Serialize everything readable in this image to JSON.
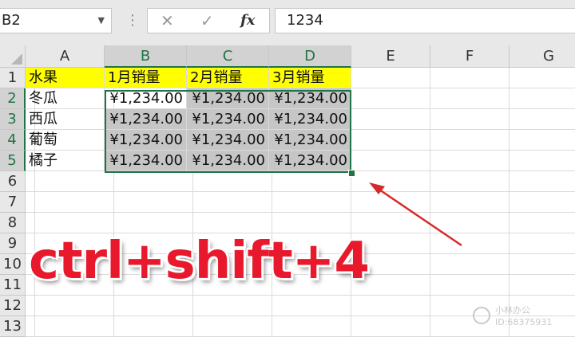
{
  "name_box": {
    "value": "B2"
  },
  "formula_bar": {
    "cancel_icon": "✕",
    "enter_icon": "✓",
    "fx_label": "fx",
    "value": "1234"
  },
  "columns": [
    "A",
    "B",
    "C",
    "D",
    "E",
    "F",
    "G"
  ],
  "rows": [
    "1",
    "2",
    "3",
    "4",
    "5",
    "6",
    "7",
    "8",
    "9",
    "10",
    "11",
    "12",
    "13"
  ],
  "cells": {
    "r1": [
      "水果",
      "1月销量",
      "2月销量",
      "3月销量"
    ],
    "r2": [
      "冬瓜",
      "¥1,234.00",
      "¥1,234.00",
      "¥1,234.00"
    ],
    "r3": [
      "西瓜",
      "¥1,234.00",
      "¥1,234.00",
      "¥1,234.00"
    ],
    "r4": [
      "葡萄",
      "¥1,234.00",
      "¥1,234.00",
      "¥1,234.00"
    ],
    "r5": [
      "橘子",
      "¥1,234.00",
      "¥1,234.00",
      "¥1,234.00"
    ]
  },
  "shortcut_text": "ctrl+shift+4",
  "watermark": {
    "line1": "小林办公",
    "line2": "ID:68375931"
  },
  "colors": {
    "header_fill": "#ffff00",
    "selection_border": "#217346",
    "shortcut": "#e8192c",
    "arrow": "#d62a2a"
  }
}
